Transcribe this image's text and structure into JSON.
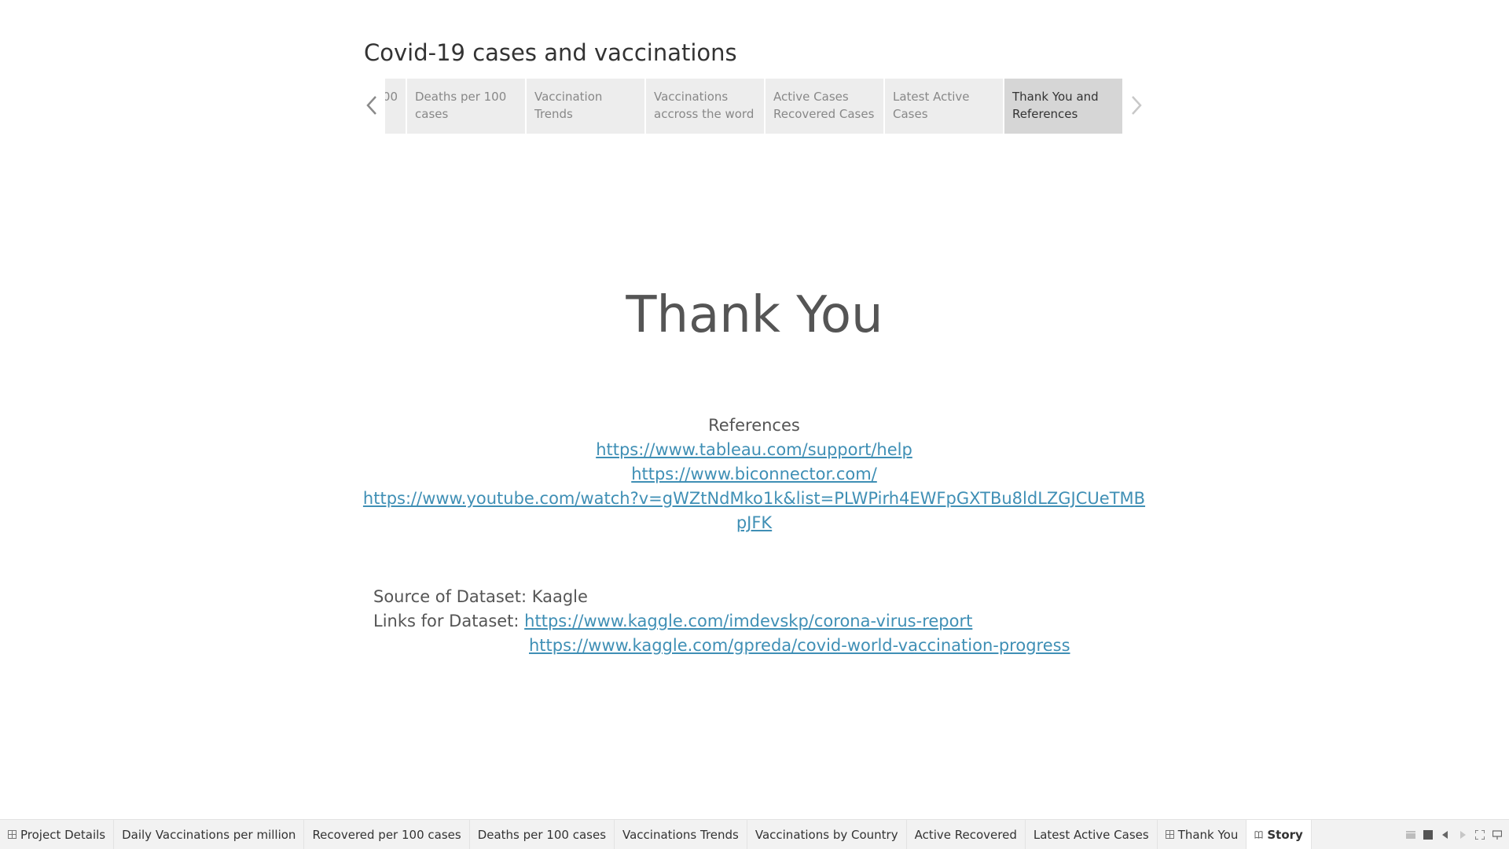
{
  "story": {
    "title": "Covid-19 cases and vaccinations",
    "points": [
      {
        "label": "00",
        "active": false
      },
      {
        "label": "Deaths per 100 cases",
        "active": false
      },
      {
        "label": "Vaccination Trends",
        "active": false
      },
      {
        "label": "Vaccinations accross the word",
        "active": false
      },
      {
        "label": "Active Cases Recovered Cases",
        "active": false
      },
      {
        "label": "Latest Active Cases",
        "active": false
      },
      {
        "label": "Thank You and References",
        "active": true
      }
    ]
  },
  "content": {
    "heading": "Thank You",
    "references_title": "References",
    "references": [
      "https://www.tableau.com/support/help",
      "https://www.biconnector.com/",
      "https://www.youtube.com/watch?v=gWZtNdMko1k&list=PLWPirh4EWFpGXTBu8ldLZGJCUeTMBpJFK"
    ],
    "source_text": "Source of Dataset: Kaagle",
    "links_label": "Links for Dataset:",
    "dataset_links": [
      "https://www.kaggle.com/imdevskp/corona-virus-report",
      "https://www.kaggle.com/gpreda/covid-world-vaccination-progress"
    ]
  },
  "tabs": [
    {
      "label": "Project Details",
      "icon": "dashboard-icon",
      "active": false
    },
    {
      "label": "Daily Vaccinations per million",
      "icon": "",
      "active": false
    },
    {
      "label": "Recovered per 100 cases",
      "icon": "",
      "active": false
    },
    {
      "label": "Deaths per 100 cases",
      "icon": "",
      "active": false
    },
    {
      "label": "Vaccinations Trends",
      "icon": "",
      "active": false
    },
    {
      "label": "Vaccinations by Country",
      "icon": "",
      "active": false
    },
    {
      "label": "Active Recovered",
      "icon": "",
      "active": false
    },
    {
      "label": "Latest Active Cases",
      "icon": "",
      "active": false
    },
    {
      "label": "Thank You",
      "icon": "dashboard-icon",
      "active": false
    },
    {
      "label": "Story",
      "icon": "story-icon",
      "active": true
    }
  ],
  "colors": {
    "link": "#3f8fb5",
    "active_point": "#d6d6d6",
    "inactive_point": "#ededed"
  }
}
